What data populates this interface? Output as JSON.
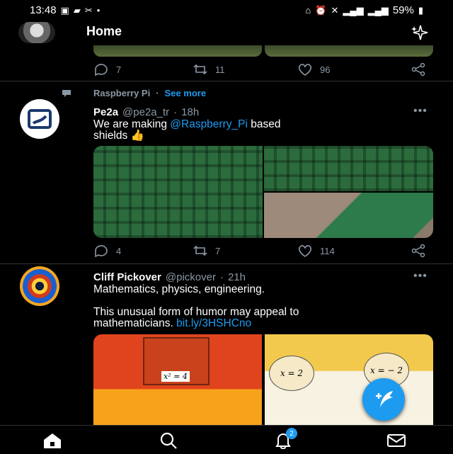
{
  "status_bar": {
    "time": "13:48",
    "battery": "59%"
  },
  "header": {
    "title": "Home"
  },
  "previous_tweet": {
    "replies": "7",
    "retweets": "11",
    "likes": "96"
  },
  "tweet1": {
    "context_label": "Raspberry Pi",
    "context_sep": "·",
    "see_more": "See more",
    "author_name": "Pe2a",
    "handle": "@pe2a_tr",
    "sep": "·",
    "time": "18h",
    "text_before": "We are making ",
    "mention": "@Raspberry_Pi",
    "text_after": " based\nshields 👍",
    "replies": "4",
    "retweets": "7",
    "likes": "114"
  },
  "tweet2": {
    "author_name": "Cliff Pickover",
    "handle": "@pickover",
    "sep": "·",
    "time": "21h",
    "line1": "Mathematics, physics, engineering.",
    "line2": "This unusual form of humor may appeal to\nmathematicians. ",
    "link": "bit.ly/3HSHCno",
    "comic_eq_1": "x² = 4",
    "comic_eq_2": "x = 2",
    "comic_eq_3": "x = − 2"
  },
  "bottom_nav": {
    "notifications_badge": "2"
  },
  "colors": {
    "accent": "#1d9bf0",
    "background": "#000000",
    "muted": "#8b98a5"
  }
}
